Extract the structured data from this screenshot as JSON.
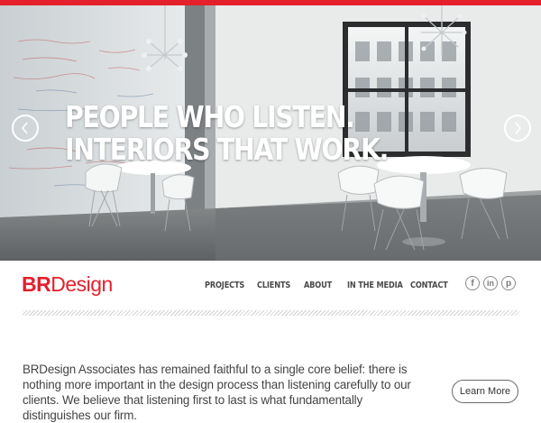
{
  "hero": {
    "headline_line1": "PEOPLE WHO LISTEN.",
    "headline_line2": "INTERIORS THAT WORK.",
    "prev_icon": "chevron-left-icon",
    "next_icon": "chevron-right-icon"
  },
  "brand": {
    "logo_bold": "BR",
    "logo_rest": "Design",
    "accent_color": "#e4202d"
  },
  "nav": {
    "items": [
      {
        "label": "PROJECTS"
      },
      {
        "label": "CLIENTS"
      },
      {
        "label": "ABOUT"
      },
      {
        "label": "IN THE MEDIA"
      },
      {
        "label": "CONTACT"
      }
    ]
  },
  "social": {
    "icons": [
      {
        "name": "facebook-icon",
        "glyph": "f"
      },
      {
        "name": "linkedin-icon",
        "glyph": "in"
      },
      {
        "name": "pinterest-icon",
        "glyph": "p"
      }
    ]
  },
  "intro": {
    "text": "BRDesign Associates has remained faithful to a single core belief: there is nothing more important in the design process than listening carefully to our clients. We believe that listening first to last is what fundamentally distinguishes our firm."
  },
  "cta": {
    "learn_more_label": "Learn More"
  }
}
